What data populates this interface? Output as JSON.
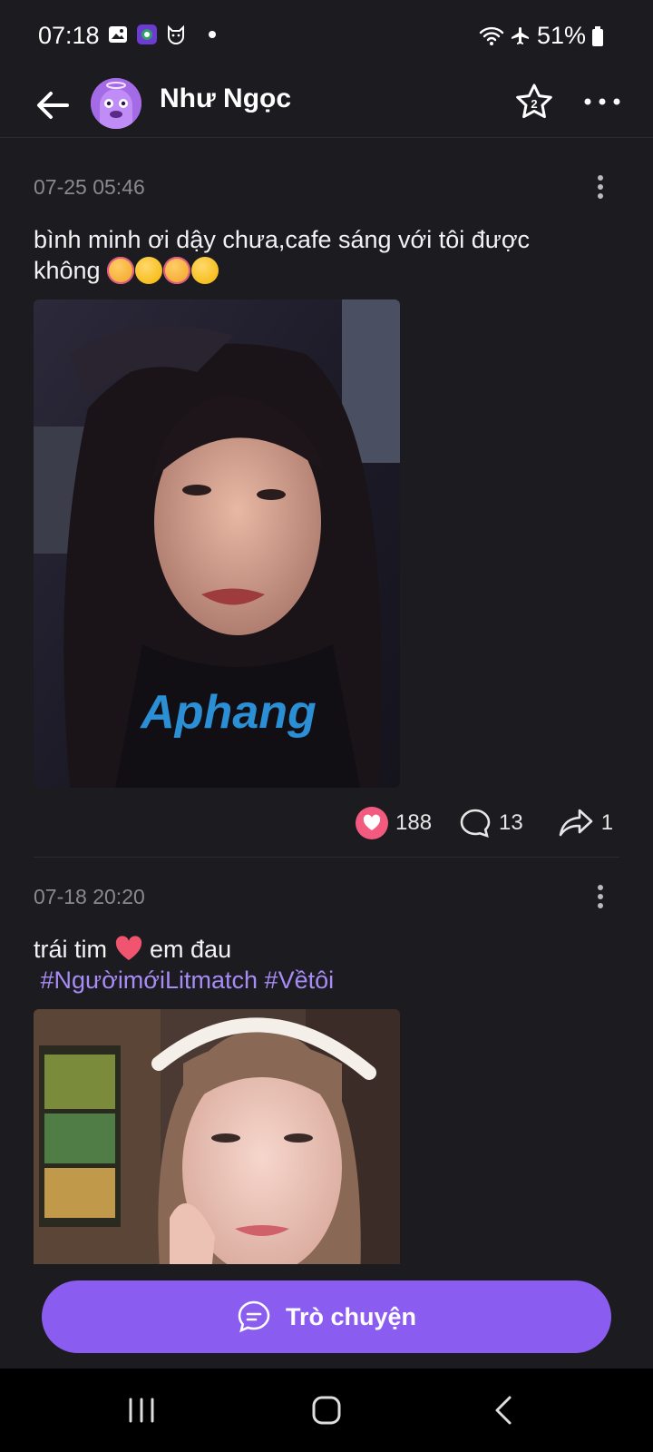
{
  "status_bar": {
    "time": "07:18",
    "battery": "51%",
    "icons": [
      "gallery-icon",
      "camera-app-icon",
      "cat-app-icon",
      "notification-dot",
      "wifi-icon",
      "airplane-icon",
      "battery-icon"
    ]
  },
  "header": {
    "name": "Như Ngọc",
    "star_badge": "2"
  },
  "posts": [
    {
      "time": "07-25 05:46",
      "text_line1": "bình minh ơi dậy chưa,cafe sáng với tôi được",
      "text_line2": "không",
      "watermark": "Aphang",
      "likes": "188",
      "comments": "13",
      "shares": "1"
    },
    {
      "time": "07-18 20:20",
      "text_before_heart": "trái tim",
      "text_after_heart": "em đau",
      "hashtags": " #NgườimớiLitmatch #Vềtôi"
    }
  ],
  "chat_button": {
    "label": "Trò chuyện"
  },
  "colors": {
    "background": "#1c1b1f",
    "accent": "#8b5cf0",
    "hashtag": "#a78bf7",
    "like": "#f25a7f"
  }
}
